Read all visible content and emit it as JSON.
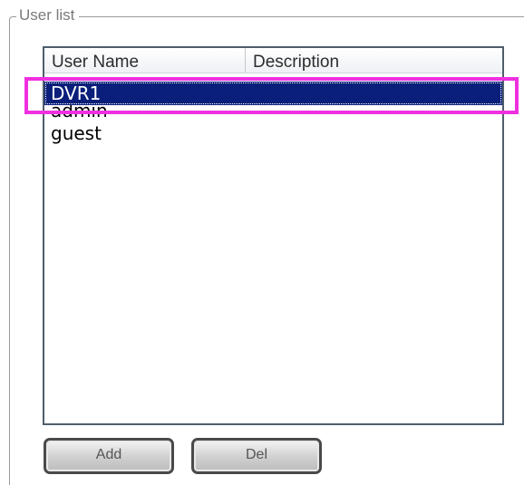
{
  "group": {
    "title": "User list"
  },
  "list": {
    "columns": [
      "User Name",
      "Description"
    ],
    "rows": [
      {
        "name": "DVR1",
        "description": "",
        "selected": true
      },
      {
        "name": "admin",
        "description": ""
      },
      {
        "name": "guest",
        "description": ""
      }
    ]
  },
  "buttons": {
    "add_label": "Add",
    "del_label": "Del"
  },
  "colors": {
    "selection": "#0a1f7a",
    "highlight": "#f030e0"
  }
}
